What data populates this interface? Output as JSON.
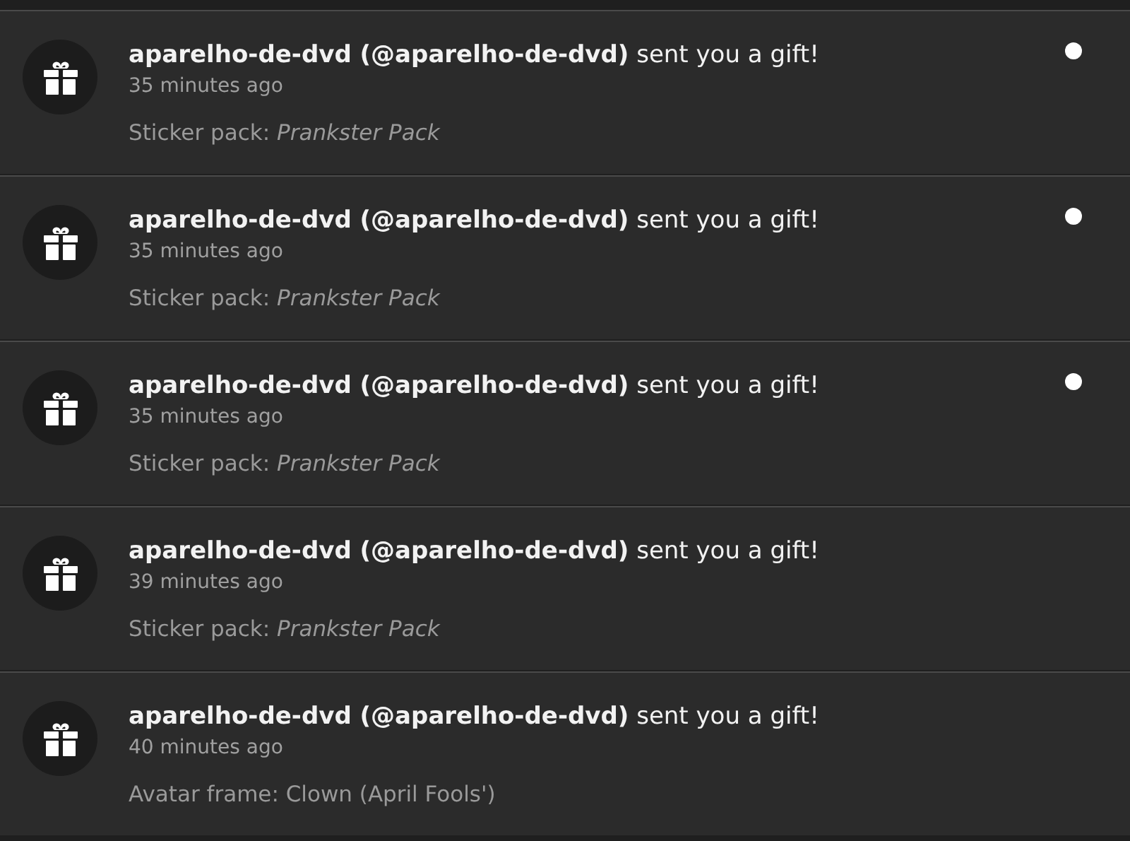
{
  "notifications": [
    {
      "title": "**aparelho-de-dvd (@aparelho-de-dvd)** sent you a gift!",
      "time": "35 minutes ago",
      "detail": "Sticker pack: *Prankster Pack*",
      "unread": true
    },
    {
      "title": "**aparelho-de-dvd (@aparelho-de-dvd)** sent you a gift!",
      "time": "35 minutes ago",
      "detail": "Sticker pack: *Prankster Pack*",
      "unread": true
    },
    {
      "title": "**aparelho-de-dvd (@aparelho-de-dvd)** sent you a gift!",
      "time": "35 minutes ago",
      "detail": "Sticker pack: *Prankster Pack*",
      "unread": true
    },
    {
      "title": "**aparelho-de-dvd (@aparelho-de-dvd)** sent you a gift!",
      "time": "39 minutes ago",
      "detail": "Sticker pack: *Prankster Pack*",
      "unread": false
    },
    {
      "title": "**aparelho-de-dvd (@aparelho-de-dvd)** sent you a gift!",
      "time": "40 minutes ago",
      "detail": "Avatar frame: Clown (April Fools')",
      "unread": false
    }
  ]
}
